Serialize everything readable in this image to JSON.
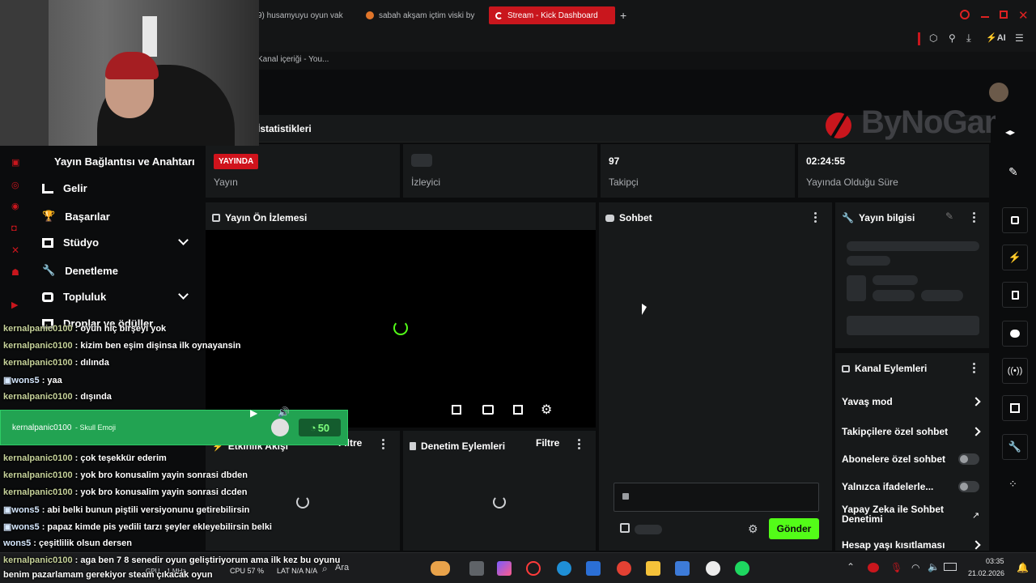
{
  "browser": {
    "tabs": [
      {
        "label": "9) husamyuyu oyun vak"
      },
      {
        "label": "sabah akşam içtim viski by"
      },
      {
        "label": "Stream - Kick Dashboard",
        "active": true
      }
    ],
    "bookmark": "Kanal içeriği - You...",
    "toolbar_ai": "AI"
  },
  "stats_title": "İstatistikleri",
  "stats": [
    {
      "value": "YAYINDA",
      "label": "Yayın"
    },
    {
      "value": "",
      "label": "İzleyici"
    },
    {
      "value": "97",
      "label": "Takipçi"
    },
    {
      "value": "02:24:55",
      "label": "Yayında Olduğu Süre"
    }
  ],
  "watermark": "ByNoGame",
  "nav": {
    "header": "Yayın Bağlantısı ve Anahtarı",
    "items": [
      {
        "label": "Gelir"
      },
      {
        "label": "Başarılar"
      },
      {
        "label": "Stüdyo"
      },
      {
        "label": "Denetleme"
      },
      {
        "label": "Topluluk"
      },
      {
        "label": "Droplar ve ödüller"
      }
    ]
  },
  "preview": {
    "title": "Yayın Ön İzlemesi"
  },
  "chat": {
    "title": "Sohbet",
    "send": "Gönder"
  },
  "stream_info": {
    "title": "Yayın bilgisi"
  },
  "channel_actions": {
    "title": "Kanal Eylemleri",
    "items": [
      {
        "label": "Yavaş mod",
        "type": "chevron"
      },
      {
        "label": "Takipçilere özel sohbet",
        "type": "chevron"
      },
      {
        "label": "Abonelere özel sohbet",
        "type": "toggle"
      },
      {
        "label": "Yalnızca ifadelerle...",
        "type": "toggle"
      },
      {
        "label": "Yapay Zeka ile Sohbet Denetimi",
        "type": "link"
      },
      {
        "label": "Hesap yaşı kısıtlaması",
        "type": "chevron"
      }
    ]
  },
  "activity": {
    "title": "Etkinlik Akışı",
    "filter": "Filtre"
  },
  "moderation": {
    "title": "Denetim Eylemleri",
    "filter": "Filtre"
  },
  "overlay_chat": {
    "lines_top": [
      {
        "user": "kernalpanic0100",
        "text": " : oyun hiç birşeyi yok"
      },
      {
        "user": "kernalpanic0100",
        "text": " : kizim ben eşim dişinsa ilk oynayansin"
      },
      {
        "user": "kernalpanic0100",
        "text": " : dılında"
      },
      {
        "user": "wons5",
        "text": " : yaa"
      },
      {
        "user": "kernalpanic0100",
        "text": " : dışında"
      }
    ],
    "highlight": {
      "user": "kernalpanic0100",
      "text": "- Skull Emoji",
      "amount": "50"
    },
    "lines_bottom": [
      {
        "user": "kernalpanic0100",
        "text": " : çok teşekkür ederim"
      },
      {
        "user": "kernalpanic0100",
        "text": " : yok bro konusalim yayin sonrasi dbden"
      },
      {
        "user": "kernalpanic0100",
        "text": " : yok bro konusalim yayin sonrasi dcden"
      },
      {
        "user": "wons5",
        "text": " : abi belki bunun piştili versiyonunu getirebilirsin"
      },
      {
        "user": "wons5",
        "text": " : papaz kimde pis yedili tarzı şeyler ekleyebilirsin belki"
      },
      {
        "user": "wons5",
        "text": " : çeşitlilik olsun dersen"
      },
      {
        "user": "kernalpanic0100",
        "text": " : aga ben 7 8 senedir oyun geliştiriyorum ama ilk kez bu oyunu"
      }
    ],
    "last_line": "benim pazarlamam gerekiyor steam çıkacak oyun"
  },
  "taskbar": {
    "search": "Ara",
    "cpu": "CPU  57 %",
    "lat": "LAT  N/A   N/A",
    "gpu": "GPU  ...1 MHz",
    "time": "03:35",
    "date": "21.02.2026"
  }
}
